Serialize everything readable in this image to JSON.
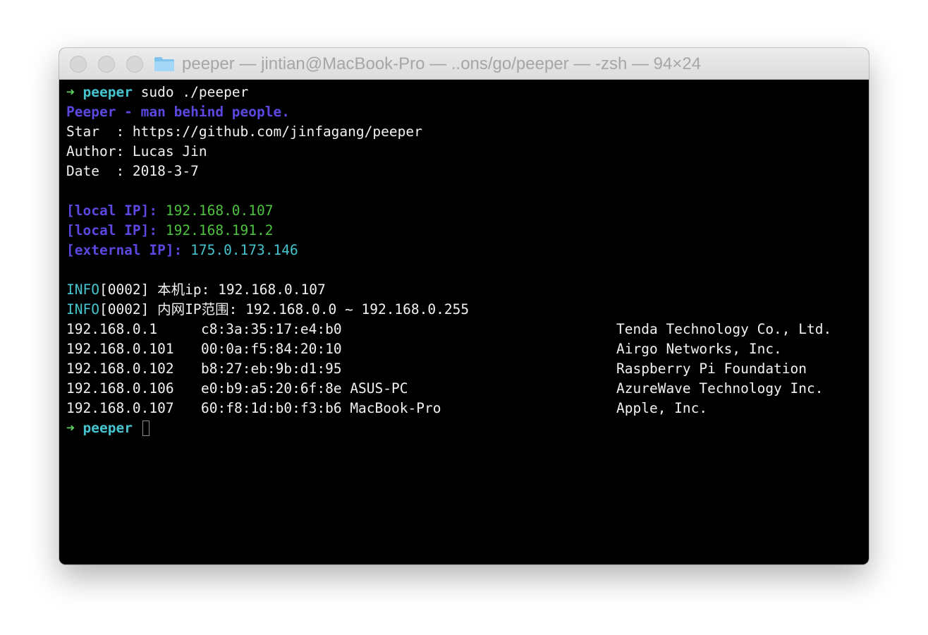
{
  "window": {
    "title": "peeper — jintian@MacBook-Pro — ..ons/go/peeper — -zsh — 94×24",
    "title_icon": "folder-icon"
  },
  "terminal": {
    "prompt1": {
      "arrow": "➜",
      "dir": "peeper",
      "command": " sudo ./peeper"
    },
    "banner": "Peeper - man behind people.",
    "star": "Star  : https://github.com/jinfagang/peeper",
    "author": "Author: Lucas Jin",
    "date": "Date  : 2018-3-7",
    "ips": [
      {
        "label": "[local IP]: ",
        "value": "192.168.0.107",
        "color": "#4ec33f"
      },
      {
        "label": "[local IP]: ",
        "value": "192.168.191.2",
        "color": "#4ec33f"
      },
      {
        "label": "[external IP]: ",
        "value": "175.0.173.146",
        "color": "#45c4cf"
      }
    ],
    "info_lines": [
      {
        "tag": "INFO",
        "text": "[0002] 本机ip: 192.168.0.107"
      },
      {
        "tag": "INFO",
        "text": "[0002] 内网IP范围: 192.168.0.0 ~ 192.168.0.255"
      }
    ],
    "devices": [
      {
        "ip": "192.168.0.1",
        "mac": "c8:3a:35:17:e4:b0",
        "vendor": "Tenda Technology Co., Ltd."
      },
      {
        "ip": "192.168.0.101",
        "mac": "00:0a:f5:84:20:10",
        "vendor": "Airgo Networks, Inc."
      },
      {
        "ip": "192.168.0.102",
        "mac": "b8:27:eb:9b:d1:95",
        "vendor": "Raspberry Pi Foundation"
      },
      {
        "ip": "192.168.0.106",
        "mac": "e0:b9:a5:20:6f:8e ASUS-PC",
        "vendor": "AzureWave Technology Inc."
      },
      {
        "ip": "192.168.0.107",
        "mac": "60:f8:1d:b0:f3:b6 MacBook-Pro",
        "vendor": "Apple, Inc."
      }
    ],
    "prompt2": {
      "arrow": "➜",
      "dir": "peeper"
    }
  },
  "colors": {
    "background": "#000000",
    "text": "#f2f2f2",
    "prompt_arrow": "#5fd35f",
    "prompt_dir": "#45c4cf",
    "banner": "#5b48e0",
    "local_ip": "#4ec33f",
    "external_ip": "#45c4cf",
    "info_tag": "#45c4cf"
  }
}
